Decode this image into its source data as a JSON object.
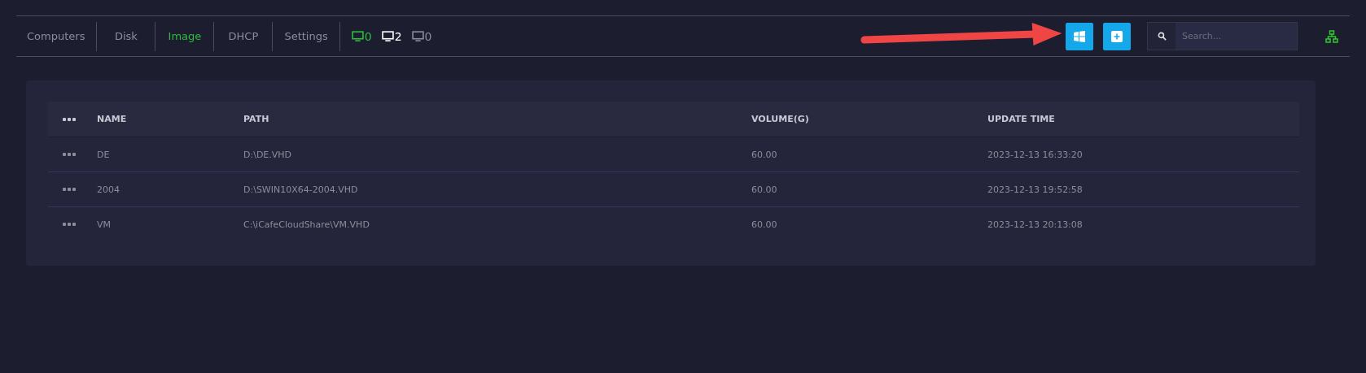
{
  "tabs": [
    {
      "label": "Computers",
      "selected": false
    },
    {
      "label": "Disk",
      "selected": false
    },
    {
      "label": "Image",
      "selected": true
    },
    {
      "label": "DHCP",
      "selected": false
    },
    {
      "label": "Settings",
      "selected": false
    }
  ],
  "counters": [
    {
      "count": "0",
      "color": "#2ebd3f"
    },
    {
      "count": "2",
      "color": "#ffffff"
    },
    {
      "count": "0",
      "color": "#8a8c99"
    }
  ],
  "toolbar": {
    "buttons": [
      {
        "kind": "windows"
      },
      {
        "kind": "add"
      }
    ],
    "search": {
      "placeholder": "Search..."
    }
  },
  "table": {
    "columns": [
      "NAME",
      "PATH",
      "VOLUME(G)",
      "UPDATE TIME"
    ],
    "rows": [
      [
        "DE",
        "D:\\DE.VHD",
        "60.00",
        "2023-12-13 16:33:20"
      ],
      [
        "2004",
        "D:\\SWIN10X64-2004.VHD",
        "60.00",
        "2023-12-13 19:52:58"
      ],
      [
        "VM",
        "C:\\iCafeCloudShare\\VM.VHD",
        "60.00",
        "2023-12-13 20:13:08"
      ]
    ]
  }
}
